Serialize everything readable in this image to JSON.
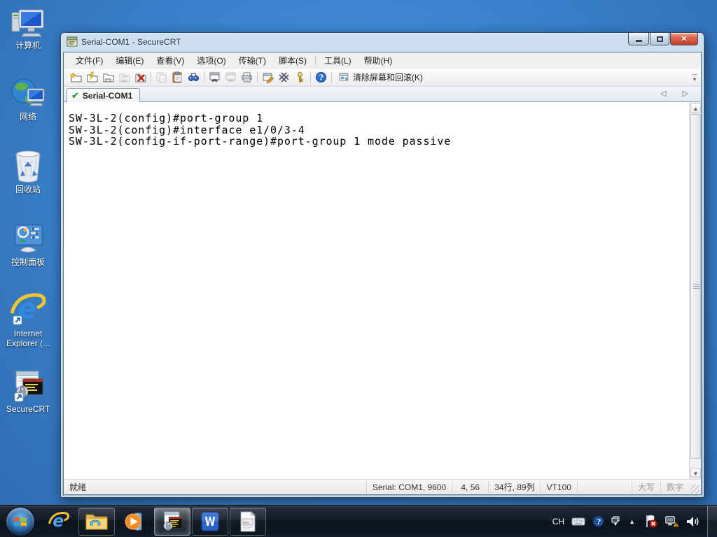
{
  "colors": {
    "desktop_blue": "#3b84cf",
    "titlebar_glass": "#bcd3e8",
    "close_button_red": "#c33c26",
    "tab_check_green": "#3aa53a",
    "terminal_bg": "#ffffff",
    "terminal_fg": "#000000",
    "taskbar_dark": "#141d29"
  },
  "desktop": {
    "icons": [
      {
        "name": "computer",
        "label": "计算机"
      },
      {
        "name": "network",
        "label": "网络"
      },
      {
        "name": "recycle-bin",
        "label": "回收站"
      },
      {
        "name": "control-panel",
        "label": "控制面板"
      },
      {
        "name": "internet-explorer",
        "label": "Internet Explorer (..."
      },
      {
        "name": "securecrt",
        "label": "SecureCRT"
      }
    ]
  },
  "window": {
    "title": "Serial-COM1 - SecureCRT",
    "menus": [
      "文件(F)",
      "编辑(E)",
      "查看(V)",
      "选项(O)",
      "传输(T)",
      "脚本(S)",
      "工具(L)",
      "帮助(H)"
    ],
    "toolbar": {
      "icons": [
        "quick-connect",
        "connect",
        "connect-in-tab",
        "reconnect",
        "disconnect",
        "copy",
        "paste",
        "find",
        "window-phone",
        "window-phone-disabled",
        "printer",
        "session-options",
        "global-options",
        "key",
        "help"
      ],
      "clear_button_label": "清除屏幕和回滚(K)"
    },
    "tab": {
      "label": "Serial-COM1"
    },
    "terminal": {
      "lines": [
        "SW-3L-2(config)#port-group 1",
        "SW-3L-2(config)#interface e1/0/3-4",
        "SW-3L-2(config-if-port-range)#port-group 1 mode passive"
      ]
    },
    "status": {
      "ready": "就绪",
      "serial": "Serial: COM1, 9600",
      "cursor": "4, 56",
      "dimensions": "34行, 89列",
      "emulation": "VT100",
      "caps_lock": "大写",
      "num_lock": "数字"
    }
  },
  "taskbar": {
    "language_indicator": "CH",
    "items": [
      "start",
      "internet-explorer",
      "windows-explorer",
      "media-player",
      "securecrt",
      "word",
      "notepad"
    ]
  }
}
